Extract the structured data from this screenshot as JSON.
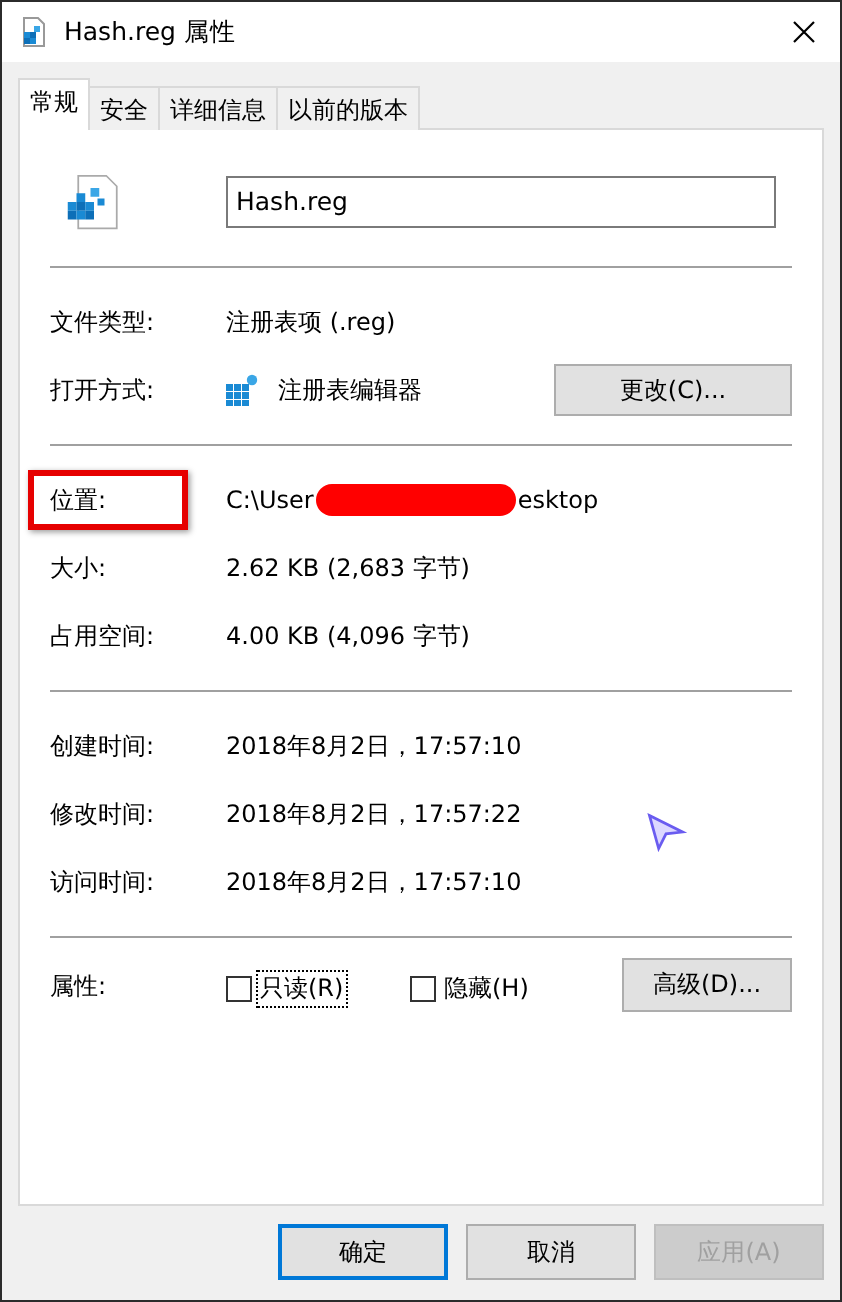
{
  "window": {
    "title": "Hash.reg 属性"
  },
  "tabs": [
    {
      "label": "常规",
      "selected": true
    },
    {
      "label": "安全",
      "selected": false
    },
    {
      "label": "详细信息",
      "selected": false
    },
    {
      "label": "以前的版本",
      "selected": false
    }
  ],
  "name_field": {
    "value": "Hash.reg"
  },
  "file_type": {
    "label": "文件类型:",
    "value": "注册表项 (.reg)"
  },
  "opens_with": {
    "label": "打开方式:",
    "value": "注册表编辑器",
    "button": "更改(C)..."
  },
  "location": {
    "label": "位置:",
    "value_start": "C:\\User",
    "value_end": "esktop",
    "highlighted": true,
    "redacted": true
  },
  "sizes": [
    {
      "label": "大小:",
      "value": "2.62 KB (2,683 字节)"
    },
    {
      "label": "占用空间:",
      "value": "4.00 KB (4,096 字节)"
    }
  ],
  "times": [
    {
      "label": "创建时间:",
      "value": "2018年8月2日，17:57:10"
    },
    {
      "label": "修改时间:",
      "value": "2018年8月2日，17:57:22"
    },
    {
      "label": "访问时间:",
      "value": "2018年8月2日，17:57:10"
    }
  ],
  "attributes": {
    "label": "属性:",
    "options": [
      {
        "label": "只读(R)",
        "checked": false,
        "focused": true
      },
      {
        "label": "隐藏(H)",
        "checked": false,
        "focused": false
      }
    ],
    "button": "高级(D)..."
  },
  "buttons": [
    {
      "label": "确定",
      "default": true,
      "disabled": false
    },
    {
      "label": "取消",
      "default": false,
      "disabled": false
    },
    {
      "label": "应用(A)",
      "default": false,
      "disabled": true
    }
  ]
}
